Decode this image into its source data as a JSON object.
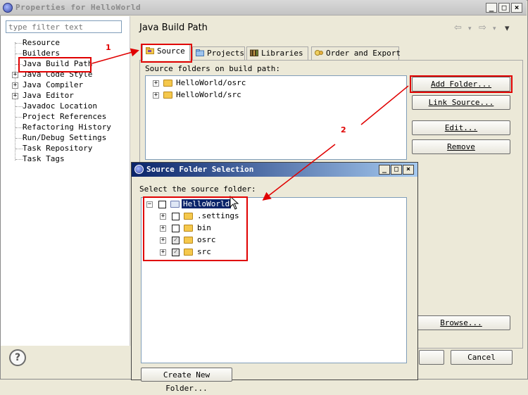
{
  "window": {
    "title": "Properties for HelloWorld",
    "minimize": "_",
    "maximize": "□",
    "close": "×"
  },
  "filter": {
    "placeholder": "type filter text"
  },
  "nav": {
    "items": [
      {
        "label": "Resource",
        "expandable": false
      },
      {
        "label": "Builders",
        "expandable": false
      },
      {
        "label": "Java Build Path",
        "expandable": false
      },
      {
        "label": "Java Code Style",
        "expandable": true
      },
      {
        "label": "Java Compiler",
        "expandable": true
      },
      {
        "label": "Java Editor",
        "expandable": true
      },
      {
        "label": "Javadoc Location",
        "expandable": false
      },
      {
        "label": "Project References",
        "expandable": false
      },
      {
        "label": "Refactoring History",
        "expandable": false
      },
      {
        "label": "Run/Debug Settings",
        "expandable": false
      },
      {
        "label": "Task Repository",
        "expandable": false
      },
      {
        "label": "Task Tags",
        "expandable": false
      }
    ]
  },
  "page": {
    "title": "Java Build Path",
    "nav_back": "⇦",
    "nav_back_menu": "▾",
    "nav_forward": "⇨",
    "nav_forward_menu": "▾",
    "view_menu": "▾"
  },
  "tabs": [
    "Source",
    "Projects",
    "Libraries",
    "Order and Export"
  ],
  "source": {
    "label": "Source folders on build path:",
    "folders": [
      "HelloWorld/osrc",
      "HelloWorld/src"
    ]
  },
  "buttons": {
    "add_folder": "Add Folder...",
    "link_source": "Link Source...",
    "edit": "Edit...",
    "remove": "Remove",
    "browse": "Browse...",
    "cancel": "Cancel"
  },
  "dialog": {
    "title": "Source Folder Selection",
    "label": "Select the source folder:",
    "root": "HelloWorld",
    "children": [
      {
        "name": ".settings",
        "checked": false
      },
      {
        "name": "bin",
        "checked": false
      },
      {
        "name": "osrc",
        "checked": true
      },
      {
        "name": "src",
        "checked": true
      }
    ],
    "create_button": "Create New Folder...",
    "minimize": "_",
    "maximize": "□",
    "close": "×"
  },
  "annotations": {
    "step1": "1",
    "step2": "2"
  },
  "help": "?",
  "colors": {
    "annotation": "#e00000",
    "selection": "#0a246a",
    "dialog_title_start": "#0a246a",
    "dialog_title_end": "#a6caf0"
  }
}
